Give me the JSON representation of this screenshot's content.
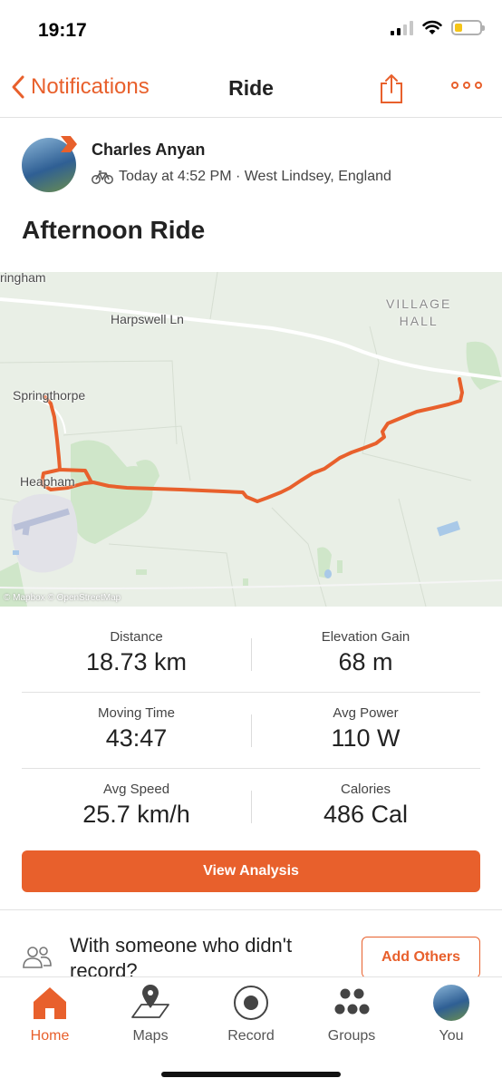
{
  "status": {
    "time": "19:17"
  },
  "nav": {
    "back_label": "Notifications",
    "title": "Ride"
  },
  "athlete": {
    "name": "Charles Anyan",
    "meta": "Today at 4:52 PM · West Lindsey, England"
  },
  "activity": {
    "title": "Afternoon Ride"
  },
  "map": {
    "labels": {
      "place1": "ringham",
      "road": "Harpswell Ln",
      "village_line1": "VILLAGE",
      "village_line2": "HALL",
      "place2": "Springthorpe",
      "place3": "Heapham"
    },
    "attribution": "© Mapbox © OpenStreetMap",
    "route_color": "#e8602c"
  },
  "stats": [
    {
      "label": "Distance",
      "value": "18.73 km"
    },
    {
      "label": "Elevation Gain",
      "value": "68 m"
    },
    {
      "label": "Moving Time",
      "value": "43:47"
    },
    {
      "label": "Avg Power",
      "value": "110 W"
    },
    {
      "label": "Avg Speed",
      "value": "25.7 km/h"
    },
    {
      "label": "Calories",
      "value": "486 Cal"
    }
  ],
  "actions": {
    "view_analysis": "View Analysis",
    "with_others": "With someone who didn't record?",
    "add_others": "Add Others"
  },
  "tabs": [
    {
      "label": "Home",
      "icon": "home-icon"
    },
    {
      "label": "Maps",
      "icon": "map-pin-icon"
    },
    {
      "label": "Record",
      "icon": "record-icon"
    },
    {
      "label": "Groups",
      "icon": "groups-icon"
    },
    {
      "label": "You",
      "icon": "avatar"
    }
  ],
  "colors": {
    "accent": "#e8602c",
    "battery": "#f5c518"
  }
}
